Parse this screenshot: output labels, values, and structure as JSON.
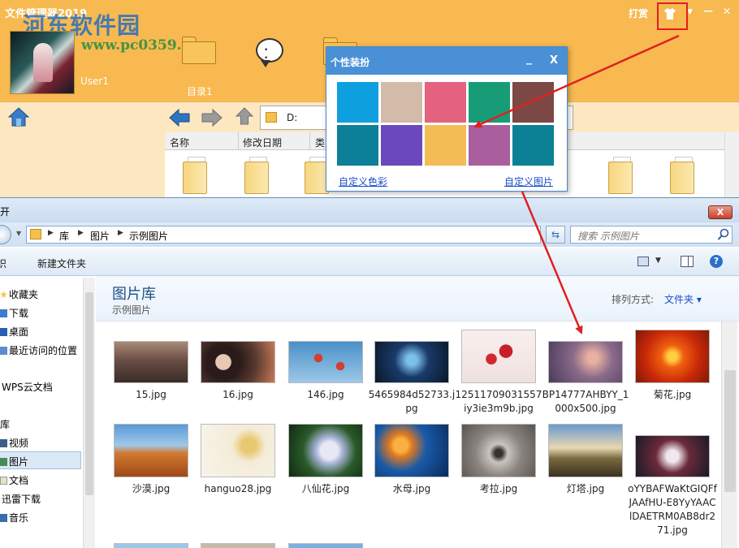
{
  "app": {
    "title": "文件管理器2019",
    "watermark": "河东软件园",
    "watermark_url": "www.pc0359.cn",
    "user_name": "User1",
    "dir_label": "目录1",
    "top_buttons": {
      "tip": "打赏",
      "minimize": "—",
      "close": "✕",
      "dropdown": "▼"
    },
    "path": "D:",
    "columns": [
      "名称",
      "修改日期",
      "类"
    ]
  },
  "popup": {
    "title": "个性装扮",
    "minimize": "_",
    "close": "X",
    "swatches": [
      "#0ea0de",
      "#d2bba9",
      "#e4617f",
      "#189c77",
      "#7c4846",
      "#0c8099",
      "#6b49bd",
      "#f4bc55",
      "#a95f9e",
      "#0c8196"
    ],
    "custom_color": "自定义色彩",
    "custom_image": "自定义图片"
  },
  "explorer": {
    "title": "开",
    "close": "X",
    "breadcrumb": [
      "库",
      "图片",
      "示例图片"
    ],
    "search_placeholder": "搜索 示例图片",
    "organize": "织",
    "new_folder": "新建文件夹",
    "library_title": "图片库",
    "library_sub": "示例图片",
    "sort_label": "排列方式:",
    "sort_value": "文件夹 ▾",
    "nav": {
      "favorites": "收藏夹",
      "downloads": "下载",
      "desktop": "桌面",
      "recent": "最近访问的位置",
      "wps": "WPS云文档",
      "library": "库",
      "videos": "视频",
      "pictures": "图片",
      "documents": "文档",
      "thunder": "迅雷下载",
      "music": "音乐"
    },
    "files": [
      {
        "name": "15.jpg"
      },
      {
        "name": "16.jpg"
      },
      {
        "name": "146.jpg"
      },
      {
        "name": "5465984d52733.jpg"
      },
      {
        "name": "12511709031557iy3ie3m9b.jpg"
      },
      {
        "name": "BP14777AHBYY_1000x500.jpg"
      },
      {
        "name": "菊花.jpg"
      },
      {
        "name": "沙漠.jpg"
      },
      {
        "name": "hanguo28.jpg"
      },
      {
        "name": "八仙花.jpg"
      },
      {
        "name": "水母.jpg"
      },
      {
        "name": "考拉.jpg"
      },
      {
        "name": "灯塔.jpg"
      },
      {
        "name": "oYYBAFWaKtGIQFfJAAfHU-E8YyYAAClDAETRM0AB8dr271.jpg"
      }
    ]
  },
  "colors": {
    "app_bg": "#f7b950",
    "accent_blue": "#4a90d6",
    "arrow_red": "#e02020"
  }
}
